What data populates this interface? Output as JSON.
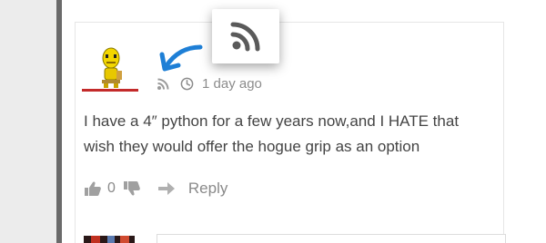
{
  "comment": {
    "time_ago": "1 day ago",
    "text_line1": "I have a 4″ python for a few years now,and I HATE that",
    "text_line2": "wish they would offer the hogue grip as an option",
    "votes": "0",
    "reply_label": "Reply"
  },
  "icons": {
    "popup": "rss-icon",
    "meta_rss": "rss-icon",
    "time": "clock-icon",
    "upvote": "thumbs-up-icon",
    "downvote": "thumbs-down-icon",
    "reply": "reply-arrow-icon",
    "annotation": "blue-arrow-annotation"
  },
  "colors": {
    "accent_red": "#c32a2a",
    "annotation_blue": "#1e7fd6",
    "meta_gray": "#8c8c8c",
    "text": "#444444"
  }
}
